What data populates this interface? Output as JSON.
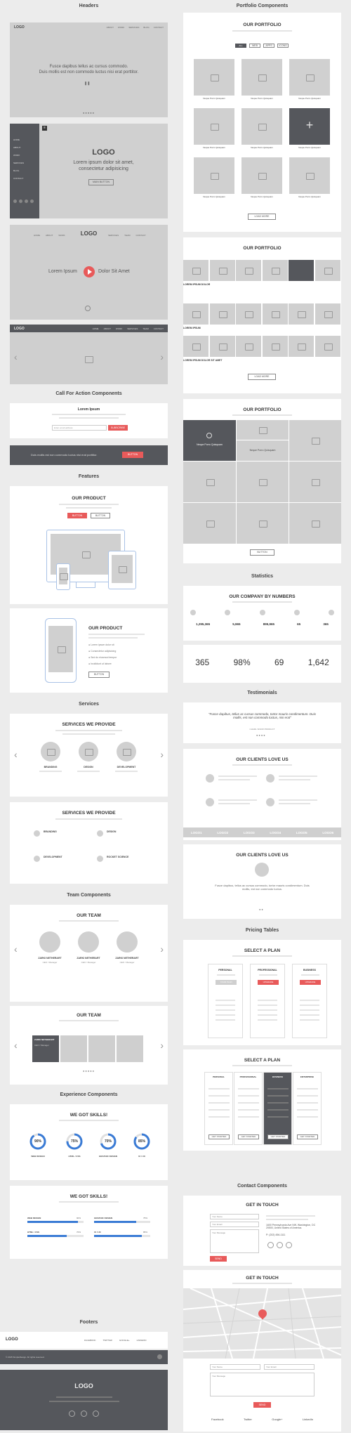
{
  "sections": {
    "headers": "Headers",
    "cta": "Call For Action Components",
    "features": "Features",
    "services": "Services",
    "team": "Team Components",
    "experience": "Experience Components",
    "footers": "Footers",
    "portfolio": "Portfolio Components",
    "statistics": "Statistics",
    "testimonials": "Testimonials",
    "pricing": "Pricing Tables",
    "contact": "Contact Components"
  },
  "header1": {
    "logo": "LOGO",
    "nav": [
      "ABOUT",
      "WORK",
      "SERVICES",
      "BLOG",
      "CONTACT"
    ],
    "line1": "Fusce dapibus tellus ac cursus commodo.",
    "line2": "Duis mollis est non commodo luctus nisi erat porttitor."
  },
  "header2": {
    "nav": [
      "HOME",
      "ABOUT",
      "WORK",
      "SERVICES",
      "BLOG",
      "CONTACT"
    ],
    "logo": "LOGO",
    "line1": "Lorem ipsum dolor sit amet,",
    "line2": "consectetur adipisicing",
    "button": "MAIN BUTTON"
  },
  "header3": {
    "logo": "LOGO",
    "nav": [
      "HOME",
      "ABOUT",
      "WORK",
      "SERVICES",
      "TEAM",
      "CONTACT"
    ],
    "left": "Lorem Ipsum",
    "right": "Dolor Sit Amet"
  },
  "header4": {
    "logo": "LOGO",
    "nav": [
      "HOME",
      "ABOUT",
      "WORK",
      "SERVICES",
      "TEAM",
      "CONTACT"
    ]
  },
  "cta1": {
    "title": "Lorem Ipsum",
    "placeholder": "Enter email address",
    "button": "SUBSCRIBE"
  },
  "cta2": {
    "text": "Duis mollis est non commodo luctus nisi erat porttitor.",
    "button": "BUTTON"
  },
  "product1": {
    "title": "OUR PRODUCT",
    "button1": "BUTTON",
    "button2": "BUTTON"
  },
  "product2": {
    "title": "OUR PRODUCT",
    "features": [
      "Lorem ipsum dolor sit",
      "Consectetur adipisicing",
      "Sed do eiusmod tempor",
      "Incididunt ut labore"
    ],
    "button": "BUTTON"
  },
  "services1": {
    "title": "SERVICES WE PROVIDE",
    "items": [
      "BRANDING",
      "DESIGN",
      "DEVELOPMENT"
    ]
  },
  "services2": {
    "title": "SERVICES WE PROVIDE",
    "items": [
      "BRANDING",
      "DESIGN",
      "DEVELOPMENT",
      "ROCKET SCIENCE"
    ]
  },
  "team1": {
    "title": "OUR TEAM",
    "members": [
      {
        "name": "ZARKI NETHERART",
        "role": "CEO / Manager"
      },
      {
        "name": "ZARKI NETHERART",
        "role": "CEO / Manager"
      },
      {
        "name": "ZARKI NETHERART",
        "role": "CEO / Manager"
      }
    ]
  },
  "team2": {
    "title": "OUR TEAM",
    "name": "ZARKI NETHERART",
    "role": "CEO / Manager"
  },
  "skills1": {
    "title": "WE GOT SKILLS!",
    "items": [
      {
        "value": "90%",
        "label": "WEB DESIGN",
        "pct": 0.9
      },
      {
        "value": "75%",
        "label": "HTML / CSS",
        "pct": 0.75
      },
      {
        "value": "70%",
        "label": "GRAPHIC DESIGN",
        "pct": 0.7
      },
      {
        "value": "85%",
        "label": "UI / UX",
        "pct": 0.85
      }
    ]
  },
  "skills2": {
    "title": "WE GOT SKILLS!",
    "items": [
      {
        "label": "WEB DESIGN",
        "value": "90%",
        "pct": 0.9
      },
      {
        "label": "GRAPHIC DESIGN",
        "value": "75%",
        "pct": 0.75
      },
      {
        "label": "HTML / CSS",
        "value": "70%",
        "pct": 0.7
      },
      {
        "label": "UI / UX",
        "value": "85%",
        "pct": 0.85
      }
    ]
  },
  "footer1": {
    "logo": "LOGO",
    "links": [
      "FACEBOOK",
      "TWITTER",
      "GOOGLE+",
      "LINKEDIN"
    ],
    "copy": "© 2015 SimpleDesign. All rights reserved."
  },
  "footer2": {
    "logo": "LOGO"
  },
  "portfolio1": {
    "title": "OUR PORTFOLIO",
    "filters": [
      "ALL",
      "WEB",
      "APPS",
      "ICONS"
    ],
    "item_title": "Neque Porro Quisquam",
    "button": "LOAD MORE"
  },
  "portfolio2": {
    "title": "OUR PORTFOLIO",
    "rows": [
      "LOREM IPSUM DOLOR",
      "LOREM IPSUM",
      "LOREM IPSUM DOLOR SIT AMET"
    ],
    "button": "LOAD MORE"
  },
  "portfolio3": {
    "title": "OUR PORTFOLIO",
    "item_title": "Neque Porro Quisquam",
    "button": "BUTTON"
  },
  "stats1": {
    "title": "OUR COMPANY BY NUMBERS",
    "items": [
      "1,295,365",
      "5,965",
      "895,965",
      "65",
      "365"
    ]
  },
  "stats2": {
    "items": [
      "365",
      "98%",
      "69",
      "1,642"
    ]
  },
  "testimonial1": {
    "quote": "\"Fusce dapibus, tellus ac cursus commodo, tortor mauris condimentum. Duis mollis, est non commodo luctus, nisi erat\"",
    "author": "CHARL SNOW PRODUCT"
  },
  "clients1": {
    "title": "OUR CLIENTS LOVE US",
    "logos": [
      "LOGO1",
      "LOGO2",
      "LOGO3",
      "LOGO4",
      "LOGO5",
      "LOGO6"
    ]
  },
  "clients2": {
    "title": "OUR CLIENTS LOVE US",
    "quote": "Fusce dapibus, tellus ac cursus commodo, tortor mauris condimentum. Duis mollis, est non commodo luctus."
  },
  "pricing1": {
    "title": "SELECT A PLAN",
    "plans": [
      {
        "name": "PERSONAL",
        "button": "YOUR PLAN"
      },
      {
        "name": "PROFESSIONAL",
        "button": "UPGRADE"
      },
      {
        "name": "BUSINESS",
        "button": "UPGRADE"
      }
    ]
  },
  "pricing2": {
    "title": "SELECT A PLAN",
    "plans": [
      "PERSONAL",
      "PROFESSIONAL",
      "BUSINESS",
      "ENTERPRISE"
    ],
    "button": "GET STARTED"
  },
  "contact1": {
    "title": "GET IN TOUCH",
    "name": "Your Name",
    "email": "Your Email",
    "message": "Your Message",
    "address": "1600 Pennsylvania Ave NW, Washington, DC 20500, United States of America.",
    "phone": "P: (202) 456-1111",
    "button": "SEND"
  },
  "contact2": {
    "title": "GET IN TOUCH",
    "name": "Your Name",
    "email": "Your Email",
    "message": "Your Message",
    "button": "SEND",
    "links": [
      "Facebook",
      "Twitter",
      "Google+",
      "LinkedIn"
    ]
  }
}
